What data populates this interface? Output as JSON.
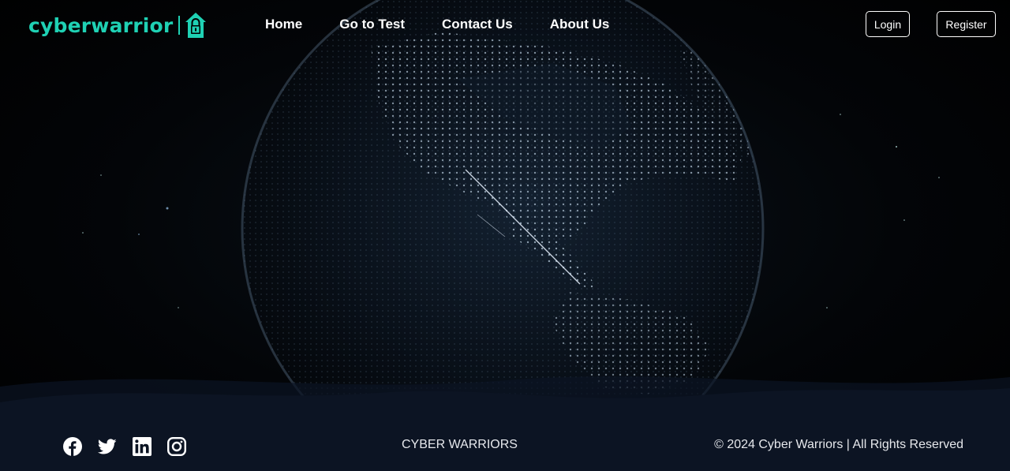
{
  "brand": {
    "name": "cyberwarrior",
    "logo_icon": "lock-house-icon",
    "color": "#1fd1b4"
  },
  "nav": {
    "items": [
      {
        "label": "Home"
      },
      {
        "label": "Go to Test"
      },
      {
        "label": "Contact Us"
      },
      {
        "label": "About Us"
      }
    ],
    "login_label": "Login",
    "register_label": "Register"
  },
  "hero": {
    "background": "digital-globe-image"
  },
  "footer": {
    "social_icons": [
      "facebook-icon",
      "twitter-icon",
      "linkedin-icon",
      "instagram-icon"
    ],
    "center_text": "CYBER WARRIORS",
    "copyright": "© 2024 Cyber Warriors | All Rights Reserved",
    "background_color": "#0c1423"
  }
}
